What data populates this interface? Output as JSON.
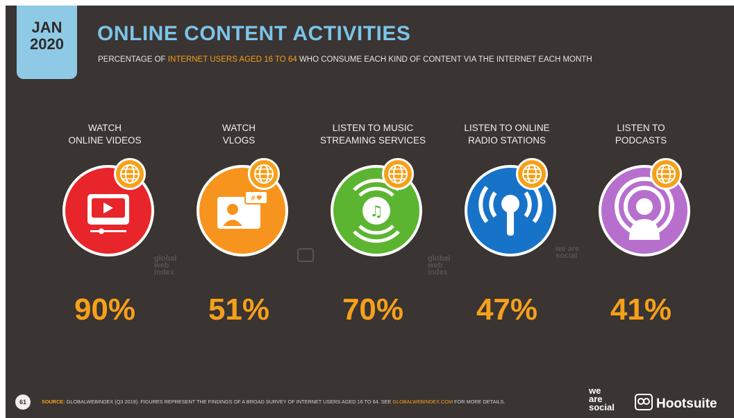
{
  "header": {
    "badge_month": "JAN",
    "badge_year": "2020",
    "title": "ONLINE CONTENT ACTIVITIES",
    "subtitle_pre": "PERCENTAGE OF ",
    "subtitle_highlight": "INTERNET USERS AGED 16 TO 64",
    "subtitle_post": " WHO CONSUME EACH KIND OF CONTENT VIA THE INTERNET EACH MONTH"
  },
  "activities": [
    {
      "line1": "WATCH",
      "line2": "ONLINE VIDEOS",
      "value": "90%",
      "color": "#e8252a",
      "icon": "video-player-icon"
    },
    {
      "line1": "WATCH",
      "line2": "VLOGS",
      "value": "51%",
      "color": "#f7941d",
      "icon": "vlog-icon"
    },
    {
      "line1": "LISTEN TO MUSIC",
      "line2": "STREAMING SERVICES",
      "value": "70%",
      "color": "#5cb531",
      "icon": "music-stream-icon"
    },
    {
      "line1": "LISTEN TO ONLINE",
      "line2": "RADIO STATIONS",
      "value": "47%",
      "color": "#1773c8",
      "icon": "radio-tower-icon"
    },
    {
      "line1": "LISTEN TO",
      "line2": "PODCASTS",
      "value": "41%",
      "color": "#b76fce",
      "icon": "podcast-icon"
    }
  ],
  "watermarks": {
    "gwi_1": "global web index",
    "gwi_2": "global web index",
    "was": "we are social"
  },
  "footer": {
    "page_number": "61",
    "source_label": "SOURCE:",
    "source_text": " GLOBALWEBINDEX (Q3 2019). FIGURES REPRESENT THE FINDINGS OF A BROAD SURVEY OF INTERNET USERS AGED 16 TO 64. SEE ",
    "source_url": "GLOBALWEBINDEX.COM",
    "source_tail": " FOR MORE DETAILS.",
    "logo_was_1": "we",
    "logo_was_2": "are",
    "logo_was_3": "social",
    "logo_hootsuite": "Hootsuite"
  },
  "colors": {
    "background": "#3a3432",
    "accent": "#f6a01a",
    "title": "#7cc4e8"
  }
}
